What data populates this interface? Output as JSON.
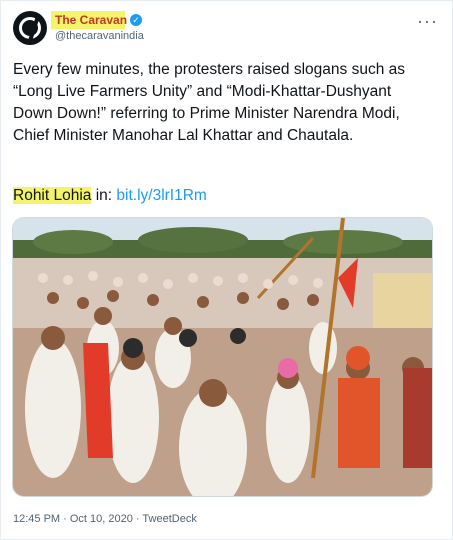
{
  "tweet": {
    "author": {
      "display_name": "The Caravan",
      "handle": "@thecaravanindia",
      "verified": true
    },
    "text": "Every few minutes, the protesters raised slogans such as “Long Live Farmers Unity” and “Modi-Khattar-Dushyant Down Down!” referring to Prime Minister Narendra Modi, Chief Minister Manohar Lal Khattar and Chautala.",
    "credit": {
      "name": "Rohit Lohia",
      "separator": " in: ",
      "link": "bit.ly/3lrI1Rm"
    },
    "timestamp": "12:45 PM · Oct 10, 2020 · TweetDeck"
  },
  "icons": {
    "verified": "verified-badge-icon",
    "more": "more-options-icon"
  },
  "colors": {
    "link": "#1d9bf0",
    "highlight": "#f4f36a",
    "display_name": "#c0392b",
    "muted": "#536471"
  }
}
